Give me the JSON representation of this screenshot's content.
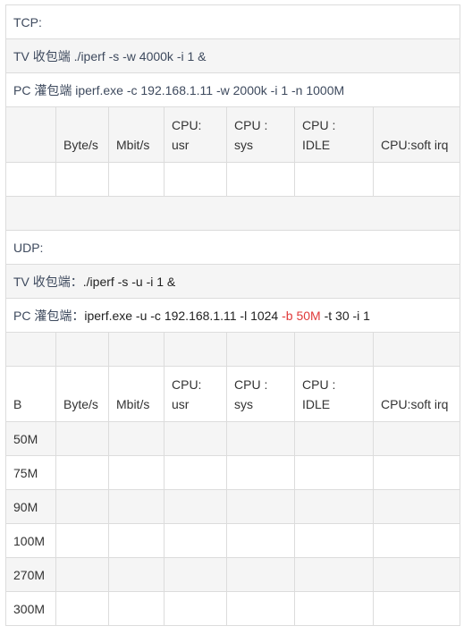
{
  "tcp": {
    "title": "TCP:",
    "tv_line": {
      "label": "TV 收包端",
      "command": " ./iperf -s -w 4000k -i 1 &"
    },
    "pc_line": {
      "label": "PC 灌包端",
      "command": " iperf.exe  -c 192.168.1.11 -w 2000k -i 1 -n 1000M"
    },
    "headers": [
      "",
      "Byte/s",
      "Mbit/s",
      "CPU: usr",
      "CPU : sys",
      "CPU : IDLE",
      "CPU:soft irq"
    ],
    "rows": [
      [
        "",
        "",
        "",
        "",
        "",
        "",
        ""
      ]
    ]
  },
  "udp": {
    "title": "UDP:",
    "tv_line": {
      "label": "TV 收包端：",
      "command": "./iperf -s -u -i 1 &"
    },
    "pc_line": {
      "label": "PC 灌包端：",
      "command_before": "iperf.exe  -u -c 192.168.1.11  -l 1024 ",
      "command_highlight": "-b 50M",
      "command_after": " -t 30 -i 1",
      "highlight_color": "#e03a3a"
    },
    "headers": [
      "B",
      "Byte/s",
      "Mbit/s",
      "CPU: usr",
      "CPU : sys",
      "CPU : IDLE",
      "CPU:soft irq"
    ],
    "rows": [
      [
        "50M",
        "",
        "",
        "",
        "",
        "",
        ""
      ],
      [
        "75M",
        "",
        "",
        "",
        "",
        "",
        ""
      ],
      [
        "90M",
        "",
        "",
        "",
        "",
        "",
        ""
      ],
      [
        "100M",
        "",
        "",
        "",
        "",
        "",
        ""
      ],
      [
        "270M",
        "",
        "",
        "",
        "",
        "",
        ""
      ],
      [
        "300M",
        "",
        "",
        "",
        "",
        "",
        ""
      ]
    ]
  }
}
